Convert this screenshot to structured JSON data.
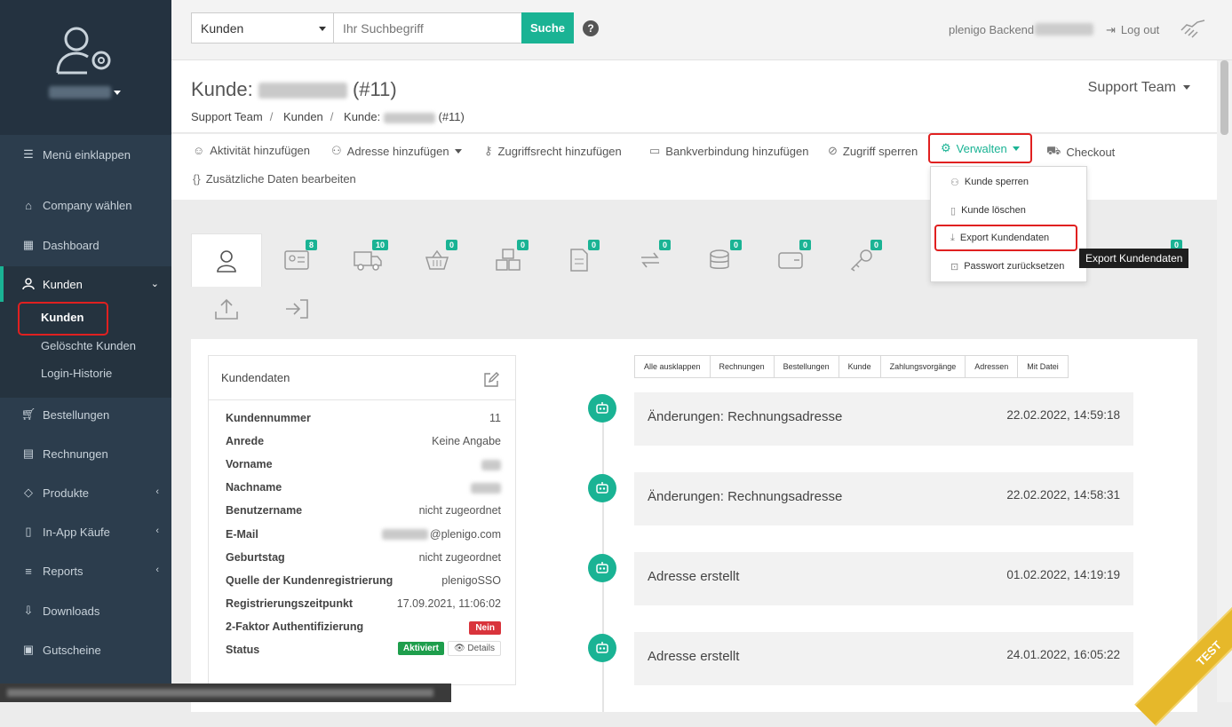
{
  "sidebar": {
    "collapse": "Menü einklappen",
    "items": [
      {
        "label": "Company wählen",
        "icon": "home-icon"
      },
      {
        "label": "Dashboard",
        "icon": "grid-icon"
      },
      {
        "label": "Kunden",
        "icon": "user-icon"
      },
      {
        "label": "Bestellungen",
        "icon": "cart-icon"
      },
      {
        "label": "Rechnungen",
        "icon": "invoice-icon"
      },
      {
        "label": "Produkte",
        "icon": "tag-icon"
      },
      {
        "label": "In-App Käufe",
        "icon": "mobile-icon"
      },
      {
        "label": "Reports",
        "icon": "chart-icon"
      },
      {
        "label": "Downloads",
        "icon": "download-icon"
      },
      {
        "label": "Gutscheine",
        "icon": "gift-icon"
      }
    ],
    "sub": [
      "Kunden",
      "Gelöschte Kunden",
      "Login-Historie"
    ]
  },
  "topbar": {
    "select_value": "Kunden",
    "search_placeholder": "Ihr Suchbegriff",
    "search_button": "Suche",
    "help": "?",
    "backend_label": "plenigo Backend",
    "logout": "Log out"
  },
  "header": {
    "title_prefix": "Kunde:",
    "title_suffix": "(#11)",
    "breadcrumb": [
      "Support Team",
      "Kunden",
      "Kunde:",
      "(#11)"
    ],
    "team": "Support Team"
  },
  "actions": [
    "Aktivität hinzufügen",
    "Adresse hinzufügen",
    "Zugriffsrecht hinzufügen",
    "Bankverbindung hinzufügen",
    "Zugriff sperren",
    "Verwalten",
    "Checkout",
    "Zusätzliche Daten bearbeiten"
  ],
  "dropdown": [
    "Kunde sperren",
    "Kunde löschen",
    "Export Kundendaten",
    "Passwort zurücksetzen"
  ],
  "tooltip": "Export Kundendaten",
  "tab_badges": [
    "8",
    "10",
    "0",
    "0",
    "0",
    "0",
    "0",
    "0",
    "0",
    "0",
    "0"
  ],
  "card": {
    "title": "Kundendaten",
    "rows": [
      {
        "k": "Kundennummer",
        "v": "11"
      },
      {
        "k": "Anrede",
        "v": "Keine Angabe"
      },
      {
        "k": "Vorname",
        "v": ""
      },
      {
        "k": "Nachname",
        "v": ""
      },
      {
        "k": "Benutzername",
        "v": "nicht zugeordnet"
      },
      {
        "k": "E-Mail",
        "v": "@plenigo.com"
      },
      {
        "k": "Geburtstag",
        "v": "nicht zugeordnet"
      },
      {
        "k": "Quelle der Kundenregistrierung",
        "v": "plenigoSSO"
      },
      {
        "k": "Registrierungszeitpunkt",
        "v": "17.09.2021, 11:06:02"
      },
      {
        "k": "2-Faktor Authentifizierung",
        "v": "Nein"
      },
      {
        "k": "Status",
        "v": "Aktiviert"
      }
    ],
    "details": "Details"
  },
  "filters": [
    "Alle ausklappen",
    "Rechnungen",
    "Bestellungen",
    "Kunde",
    "Zahlungsvorgänge",
    "Adressen",
    "Mit Datei"
  ],
  "timeline": [
    {
      "title": "Änderungen: Rechnungsadresse",
      "time": "22.02.2022, 14:59:18"
    },
    {
      "title": "Änderungen: Rechnungsadresse",
      "time": "22.02.2022, 14:58:31"
    },
    {
      "title": "Adresse erstellt",
      "time": "01.02.2022, 14:19:19"
    },
    {
      "title": "Adresse erstellt",
      "time": "24.01.2022, 16:05:22"
    }
  ],
  "ribbon": "TEST"
}
